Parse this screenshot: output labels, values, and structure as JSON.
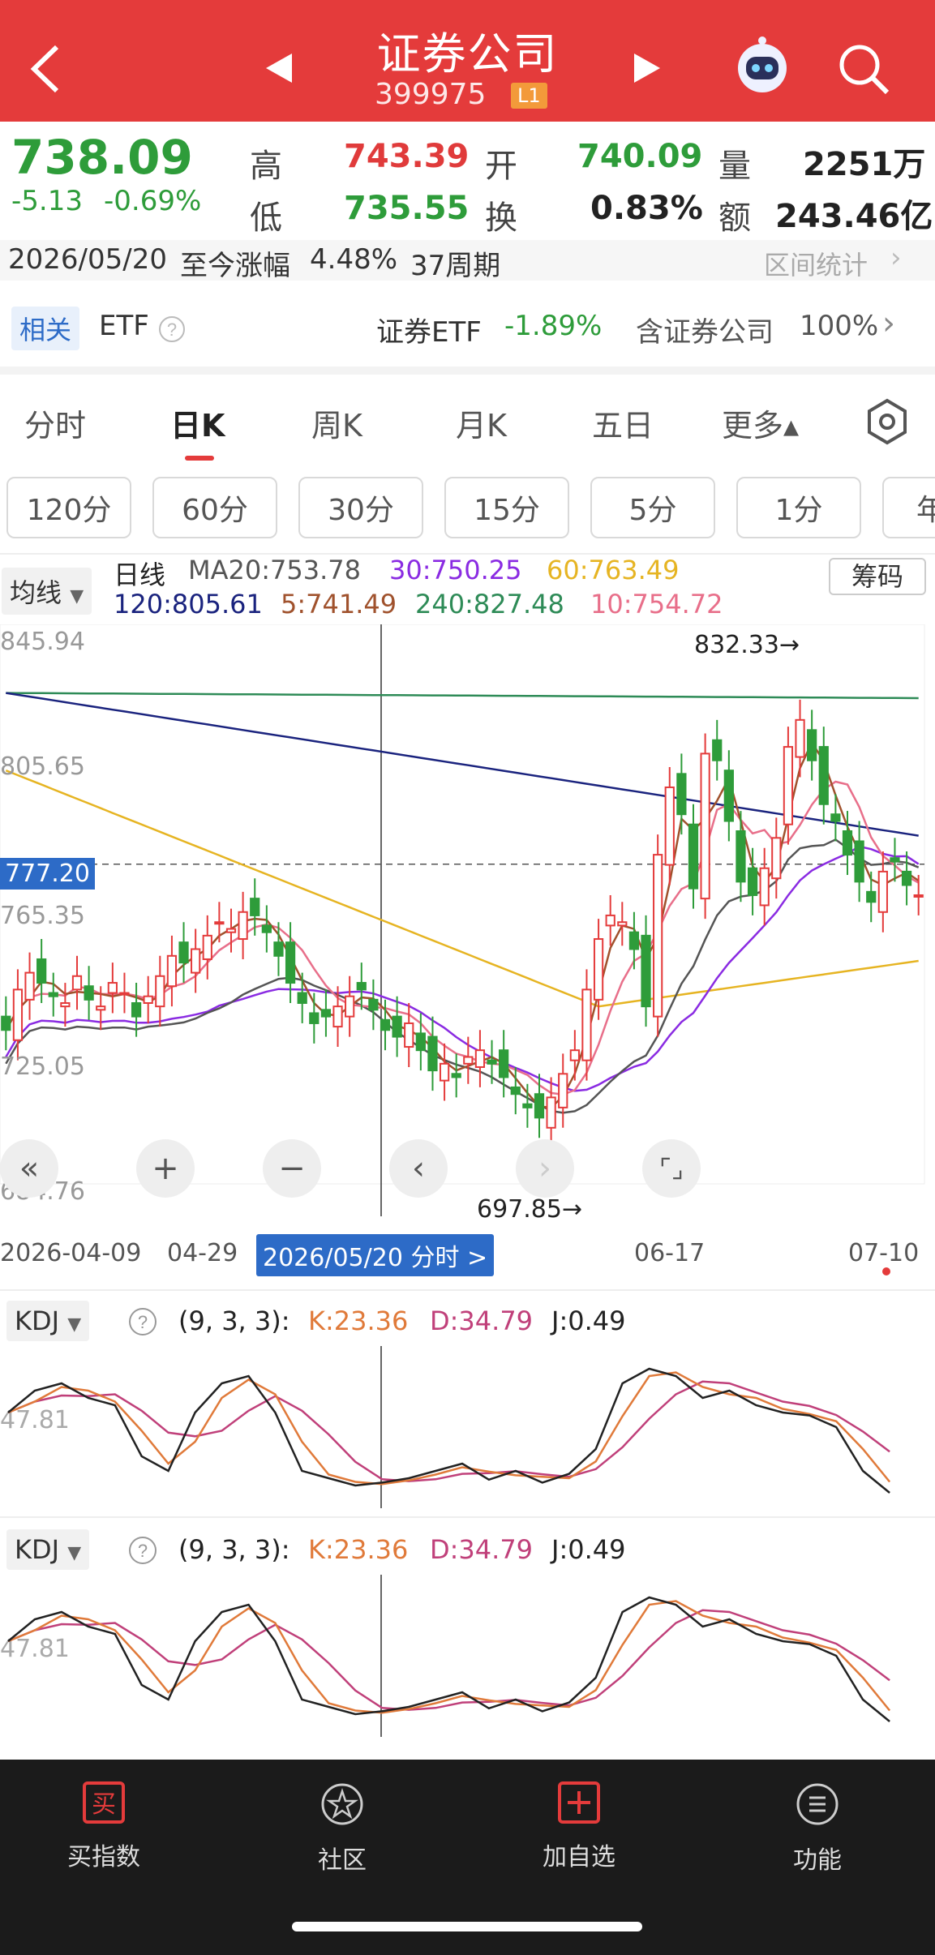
{
  "header": {
    "title": "证券公司",
    "code": "399975",
    "level": "L1"
  },
  "quote": {
    "price": "738.09",
    "change": "-5.13",
    "change_pct": "-0.69%",
    "high_label": "高",
    "high": "743.39",
    "open_label": "开",
    "open": "740.09",
    "vol_label": "量",
    "vol": "2251万",
    "low_label": "低",
    "low": "735.55",
    "turn_label": "换",
    "turn": "0.83%",
    "amt_label": "额",
    "amt": "243.46亿"
  },
  "range": {
    "date": "2026/05/20",
    "text": "至今涨幅",
    "pct": "4.48%",
    "periods": "37周期",
    "stat": "区间统计"
  },
  "etf": {
    "tag": "相关",
    "label": "ETF",
    "name": "证券ETF",
    "pct": "-1.89%",
    "contains": "含证券公司",
    "weight": "100%"
  },
  "tabs": [
    "分时",
    "日K",
    "周K",
    "月K",
    "五日",
    "更多▴"
  ],
  "minute_buttons": [
    "120分",
    "60分",
    "30分",
    "15分",
    "5分",
    "1分",
    "年"
  ],
  "ma": {
    "selector": "均线",
    "period": "日线",
    "ma20": "MA20:753.78",
    "ma30": "30:750.25",
    "ma60": "60:763.49",
    "ma120": "120:805.61",
    "ma5": "5:741.49",
    "ma240": "240:827.48",
    "ma10": "10:754.72",
    "chip": "筹码"
  },
  "chart": {
    "y_labels": [
      "845.94",
      "805.65",
      "765.35",
      "725.05",
      "684.76"
    ],
    "crosshair_price": "777.20",
    "max_label": "832.33→",
    "min_label": "697.85→",
    "x_labels": [
      "2026-04-09",
      "04-29",
      "06-17",
      "07-10"
    ],
    "date_tag": "2026/05/20 分时 >"
  },
  "chart_data": {
    "type": "candlestick",
    "ylim": [
      684.76,
      845.94
    ],
    "x_range": [
      "2026-04-09",
      "07-10"
    ],
    "high": 832.33,
    "low": 697.85,
    "crosshair": 777.2,
    "ma_values": {
      "MA5": 741.49,
      "MA10": 754.72,
      "MA20": 753.78,
      "MA30": 750.25,
      "MA60": 763.49,
      "MA120": 805.61,
      "MA240": 827.48
    }
  },
  "kdj1": {
    "name": "KDJ",
    "params": "(9, 3, 3):",
    "k": "K:23.36",
    "d": "D:34.79",
    "j": "J:0.49",
    "mid": "47.81"
  },
  "kdj2": {
    "name": "KDJ",
    "params": "(9, 3, 3):",
    "k": "K:23.36",
    "d": "D:34.79",
    "j": "J:0.49",
    "mid": "47.81"
  },
  "nav": [
    {
      "label": "买指数",
      "icon": "buy-icon"
    },
    {
      "label": "社区",
      "icon": "community-icon"
    },
    {
      "label": "加自选",
      "icon": "add-watchlist-icon"
    },
    {
      "label": "功能",
      "icon": "menu-icon"
    }
  ],
  "colors": {
    "red": "#e43b3b",
    "green": "#2e9c3a",
    "ma5": "#a0522d",
    "ma10": "#e86f8a",
    "ma20": "#555555",
    "ma30": "#8a2be2",
    "ma60": "#e6b422",
    "ma120": "#1a237e",
    "ma240": "#2e8b57"
  }
}
